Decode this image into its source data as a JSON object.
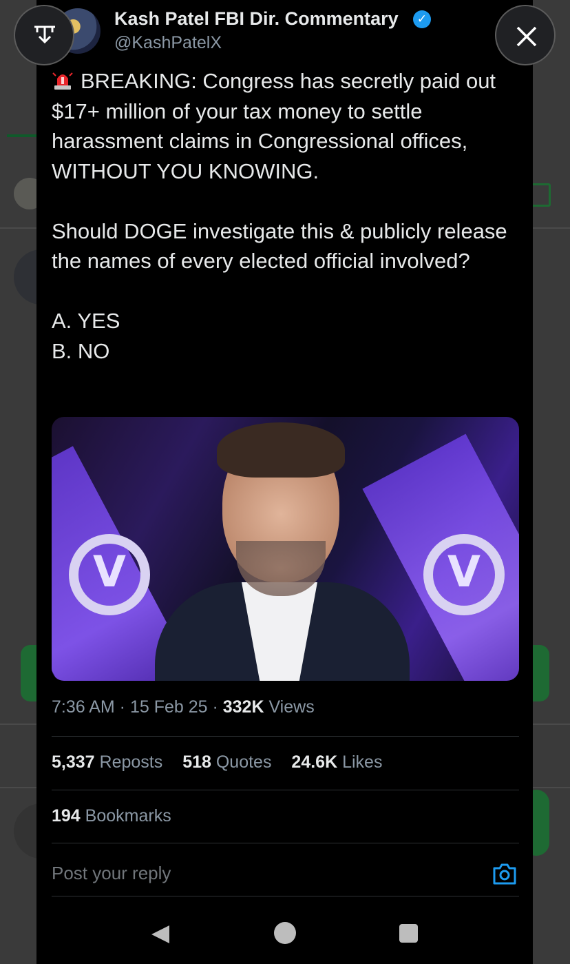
{
  "author": {
    "name": "Kash Patel FBI Dir. Commentary",
    "handle": "@KashPatelX"
  },
  "post": {
    "text": "BREAKING: Congress has secretly paid out $17+ million of your tax money to settle harassment claims in Congressional offices, WITHOUT YOU KNOWING.\n\nShould DOGE investigate this & publicly release the names of every elected official involved?\n\nA. YES\nB. NO",
    "time": "7:36 AM · 15 Feb 25 · ",
    "views_count": "332K",
    "views_label": " Views"
  },
  "stats": {
    "reposts_count": "5,337",
    "reposts_label": " Reposts",
    "quotes_count": "518",
    "quotes_label": " Quotes",
    "likes_count": "24.6K",
    "likes_label": " Likes",
    "bookmarks_count": "194",
    "bookmarks_label": " Bookmarks"
  },
  "reply": {
    "placeholder": "Post your reply"
  },
  "icons": {
    "download": "download-icon",
    "close": "close-icon",
    "verified": "verified-badge-icon",
    "siren": "siren-emoji-icon",
    "camera": "camera-icon",
    "back": "nav-back-icon",
    "home": "nav-home-icon",
    "recents": "nav-recents-icon"
  },
  "colors": {
    "background": "#000000",
    "text": "#e7e9ea",
    "muted": "#8b98a5",
    "accent": "#1d9bf0"
  }
}
